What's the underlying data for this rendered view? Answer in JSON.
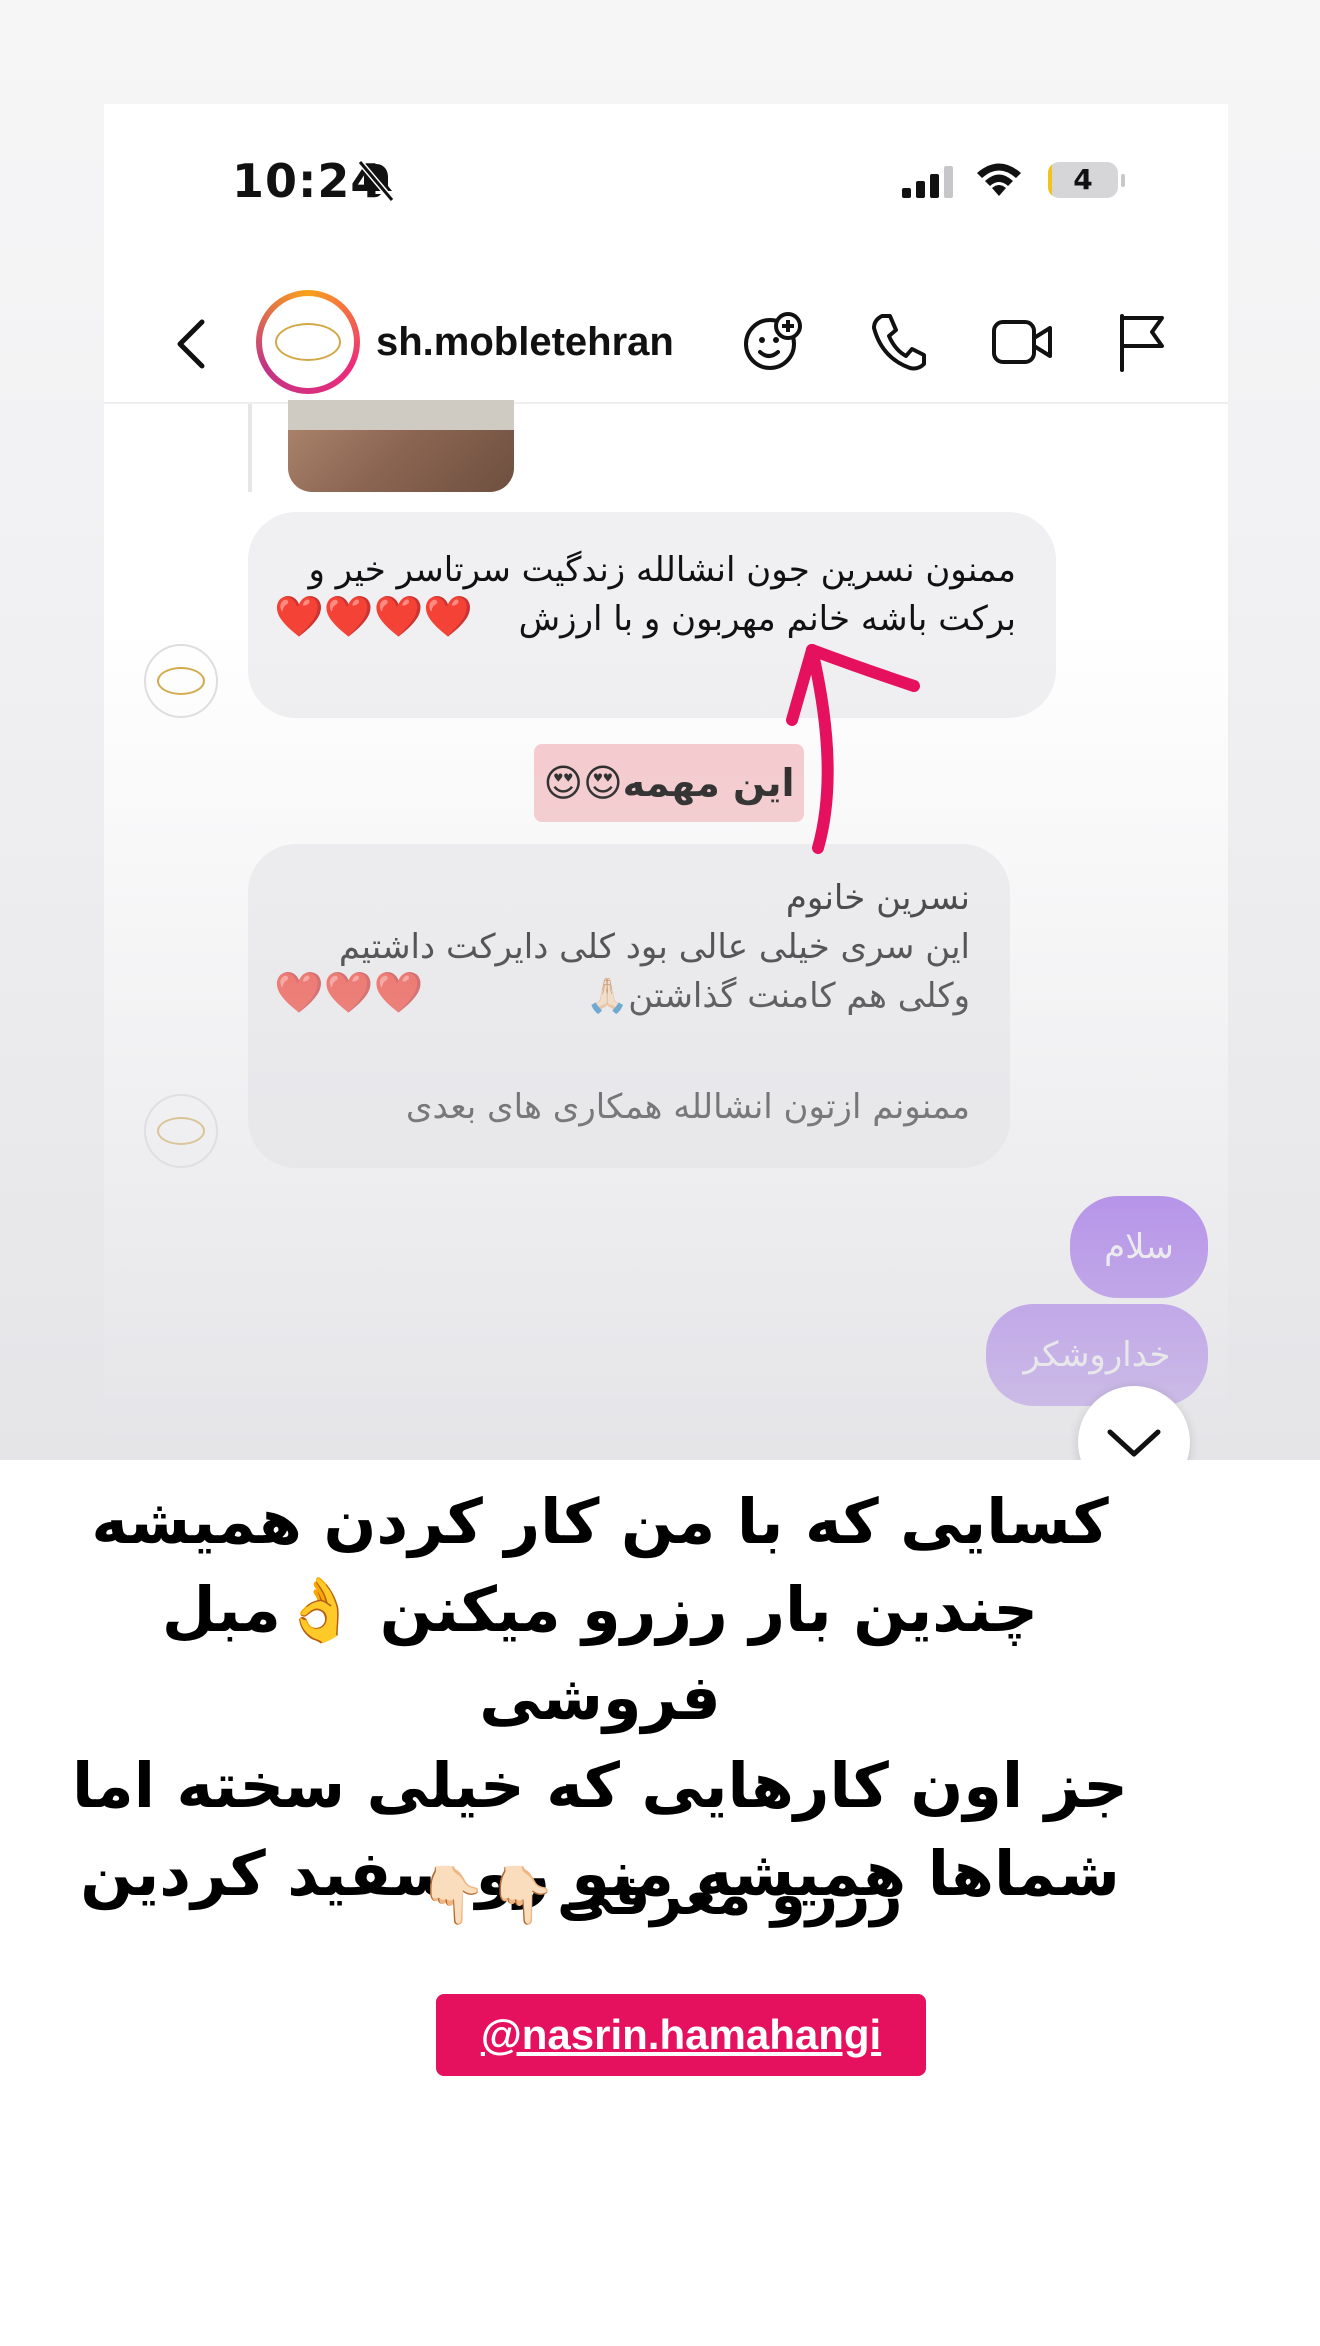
{
  "status_bar": {
    "time": "10:24",
    "battery": "4",
    "battery_level": 0.04,
    "icons": [
      "bell-slash-icon",
      "cellular-signal-icon",
      "wifi-icon",
      "battery-icon"
    ]
  },
  "header": {
    "username": "sh.mobletehran",
    "icons": [
      "back-chevron-icon",
      "avatar-icon",
      "sticker-plus-icon",
      "phone-icon",
      "video-camera-icon",
      "flag-icon"
    ]
  },
  "messages": {
    "received_1": {
      "text": "ممنون نسرین جون انشالله زندگیت سرتاسر خیر و برکت باشه خانم مهربون و با ارزش",
      "emoji": "❤️❤️❤️❤️"
    },
    "sticker_label": "این مهمه😍😍",
    "received_2": {
      "line1": "نسرین خانوم",
      "line2": "این سری خیلی عالی بود کلی دایرکت داشتیم",
      "line3": "وکلی هم کامنت گذاشتن🙏🏻",
      "hearts": "❤️❤️❤️",
      "line4": "ممنونم ازتون انشالله همکاری های بعدی"
    },
    "sent_1": "سلام",
    "sent_2": "خداروشکر"
  },
  "caption": {
    "line1": "کسایی که با من کار کردن  همیشه",
    "line2": "چندین بار رزرو میکنن 👌مبل فروشی",
    "line3": "جز اون کارهایی که خیلی سخته اما",
    "line4": "شماها همیشه منو رو سفید کردین",
    "line5": "رزرو معرفی👇🏻👇🏻",
    "mention": "@nasrin.hamahangi"
  },
  "colors": {
    "sent_bubble": "#7c2bf0",
    "received_bubble": "#f0f0f2",
    "mention_bg": "#e5105e",
    "arrow": "#e5105e",
    "sticker_bg": "#f7c9cc"
  }
}
